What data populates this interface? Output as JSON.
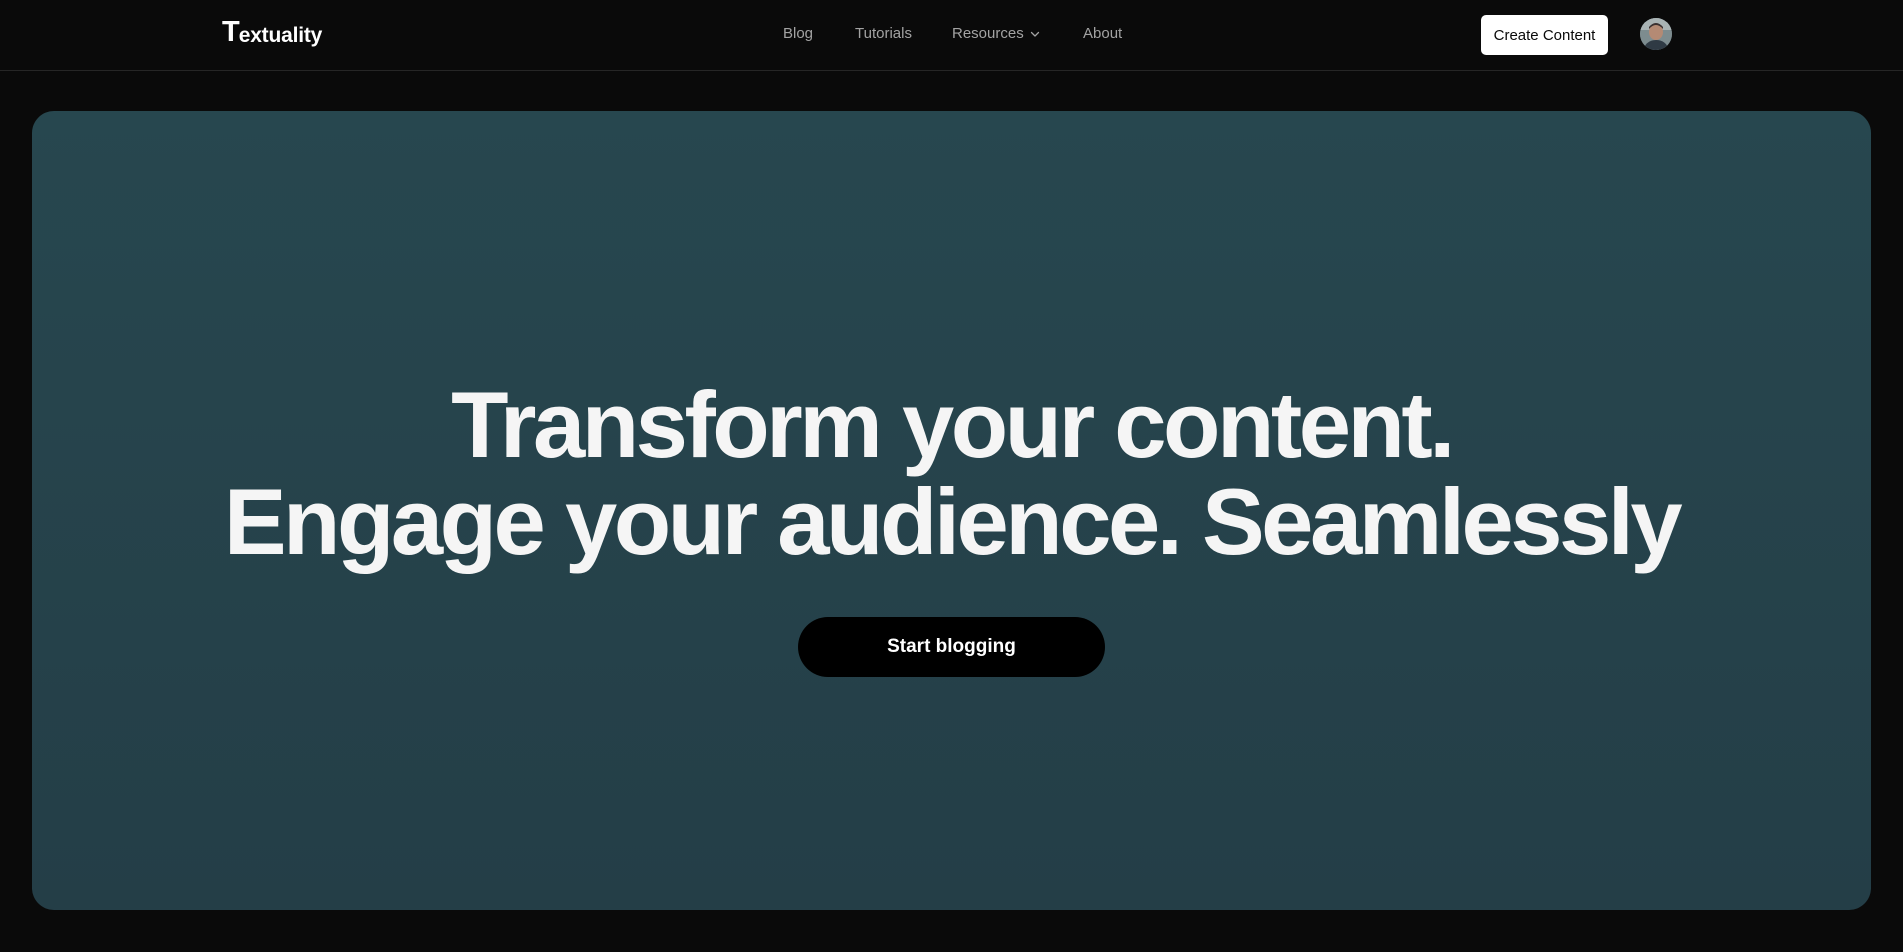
{
  "brand": {
    "initial": "T",
    "rest": "extuality"
  },
  "nav": {
    "items": [
      {
        "label": "Blog"
      },
      {
        "label": "Tutorials"
      },
      {
        "label": "Resources",
        "icon": "chevron-down-icon"
      },
      {
        "label": "About"
      }
    ],
    "create_label": "Create Content",
    "avatar_icon": "user-avatar"
  },
  "hero": {
    "line1": "Transform your content.",
    "line2": "Engage your audience. Seamlessly",
    "cta_label": "Start blogging"
  },
  "colors": {
    "page_background": "#0a0a0a",
    "hero_background": "#264650",
    "nav_text": "#a3a3a3",
    "cta_background": "#000000",
    "create_button_background": "#ffffff"
  }
}
